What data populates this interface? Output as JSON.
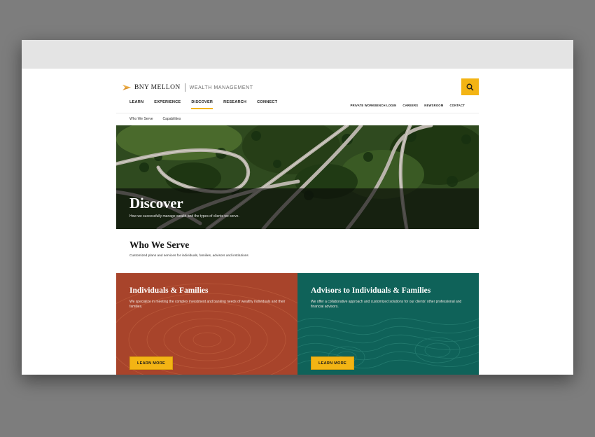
{
  "header": {
    "brand": "BNY MELLON",
    "subbrand": "WEALTH MANAGEMENT",
    "search_icon": "search-icon",
    "accent": "#f3b414"
  },
  "main_nav": [
    {
      "label": "LEARN"
    },
    {
      "label": "EXPERIENCE"
    },
    {
      "label": "DISCOVER",
      "active": true
    },
    {
      "label": "RESEARCH"
    },
    {
      "label": "CONNECT"
    }
  ],
  "util_nav": [
    {
      "label": "PRIVATE WORKBENCH LOGIN"
    },
    {
      "label": "CAREERS"
    },
    {
      "label": "NEWSROOM"
    },
    {
      "label": "CONTACT"
    }
  ],
  "sub_nav": [
    {
      "label": "Who We Serve"
    },
    {
      "label": "Capabilities"
    }
  ],
  "hero": {
    "title": "Discover",
    "subtitle": "How we successfully manage wealth and the types of clients we serve."
  },
  "section": {
    "title": "Who We Serve",
    "subtitle": "Customized plans and services for individuals, families, advisors and institutions"
  },
  "cards": [
    {
      "title": "Individuals & Families",
      "text": "We specialize in meeting the complex investment and banking needs of wealthy individuals and their families.",
      "button": "LEARN MORE",
      "color": "#a8442b"
    },
    {
      "title": "Advisors to Individuals & Families",
      "text": "We offer a collaborative approach and customized solutions for our clients' other professional and financial advisors.",
      "button": "LEARN MORE",
      "color": "#0f6259"
    }
  ]
}
